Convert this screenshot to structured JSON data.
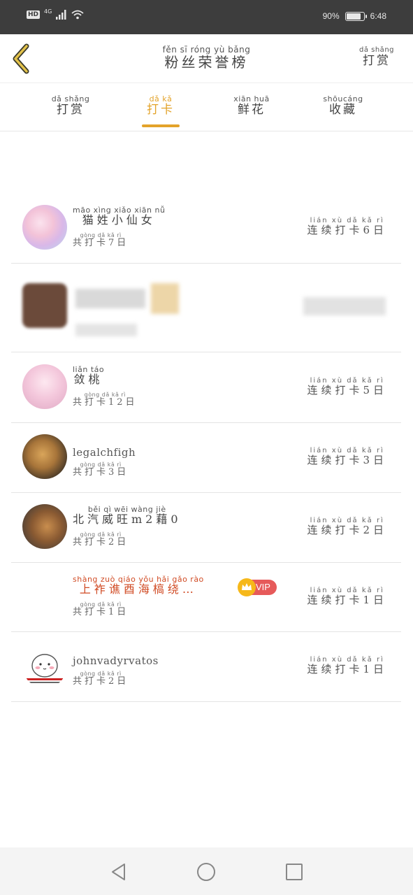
{
  "status_bar": {
    "network": "4G",
    "hd": "HD",
    "battery": "90%",
    "battery_level": 0.9,
    "time": "6:48"
  },
  "header": {
    "title_pinyin": "fěn sī róng yù bǎng",
    "title": "粉丝荣誉榜",
    "reward_pinyin": "dǎ shǎng",
    "reward": "打赏"
  },
  "tabs": [
    {
      "pinyin": "dǎ shǎng",
      "label": "打赏",
      "active": false
    },
    {
      "pinyin": "dǎ kǎ",
      "label": "打卡",
      "active": true
    },
    {
      "pinyin": "xiān huā",
      "label": "鲜花",
      "active": false
    },
    {
      "pinyin": "shōucáng",
      "label": "收藏",
      "active": false
    }
  ],
  "accent_color": "#e3a32a",
  "list": [
    {
      "name_pinyin": "māo xìng xiǎo xiān nǚ",
      "name": "猫姓小仙女",
      "total_pinyin": "gòng dǎ kǎ rì",
      "total": "共打卡7日",
      "streak_pinyin": "lián xù dǎ kǎ rì",
      "streak": "连续打卡6日"
    },
    {
      "blurred": true
    },
    {
      "name_pinyin": "liǎn táo",
      "name": "敛桃",
      "total_pinyin": "gòng dǎ kǎ rì",
      "total": "共打卡12日",
      "streak_pinyin": "lián xù dǎ kǎ rì",
      "streak": "连续打卡5日"
    },
    {
      "name": "legalchfigh",
      "total_pinyin": "gòng dǎ kǎ rì",
      "total": "共打卡3日",
      "streak_pinyin": "lián xù dǎ kǎ rì",
      "streak": "连续打卡3日"
    },
    {
      "name_pinyin": "běi qì wēi wàng jiè",
      "name": "北汽威旺m2藉0",
      "total_pinyin": "gòng dǎ kǎ rì",
      "total": "共打卡2日",
      "streak_pinyin": "lián xù dǎ kǎ rì",
      "streak": "连续打卡2日"
    },
    {
      "name_pinyin": "shàng zuò qiáo yǒu hǎi gǎo rào",
      "name": "上祚谯酉海槁绕…",
      "vip": "VIP",
      "total_pinyin": "gòng dǎ kǎ rì",
      "total": "共打卡1日",
      "streak_pinyin": "lián xù dǎ kǎ rì",
      "streak": "连续打卡1日"
    },
    {
      "name": "johnvadyrvatos",
      "total_pinyin": "gòng dǎ kǎ rì",
      "total": "共打卡2日",
      "streak_pinyin": "lián xù dǎ kǎ rì",
      "streak": "连续打卡1日"
    }
  ]
}
